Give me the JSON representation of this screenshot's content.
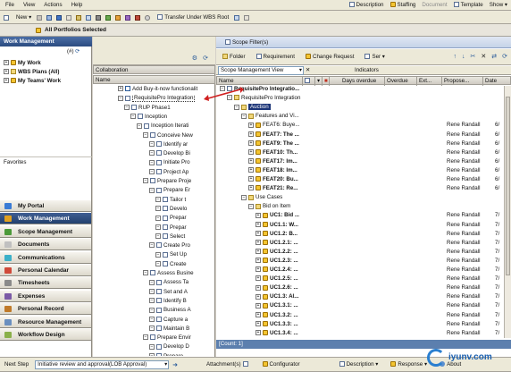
{
  "menubar": {
    "items": [
      "File",
      "View",
      "Actions",
      "Help"
    ],
    "right": [
      "Description",
      "Staffing",
      "Document",
      "Template",
      "Show"
    ]
  },
  "toolbar": {
    "new_label": "New",
    "transfer_label": "Transfer Under WBS Root",
    "scope_title": "All Portfolios Selected"
  },
  "left_panel": {
    "title": "Work Management",
    "items": [
      {
        "label": "My Work"
      },
      {
        "label": "WBS Plans (All)"
      },
      {
        "label": "My Teams' Work"
      }
    ],
    "count_label": "(#)",
    "favorites_label": "Favorites"
  },
  "nav": {
    "items": [
      {
        "label": "My Portal",
        "color": "#3a7bd5",
        "active": false
      },
      {
        "label": "Work Management",
        "color": "#e0a020",
        "active": true
      },
      {
        "label": "Scope Management",
        "color": "#4c9a3a",
        "active": false
      },
      {
        "label": "Documents",
        "color": "#c0c0c0",
        "active": false
      },
      {
        "label": "Communications",
        "color": "#3bb0c9",
        "active": false
      },
      {
        "label": "Personal Calendar",
        "color": "#d04a3a",
        "active": false
      },
      {
        "label": "Timesheets",
        "color": "#8a8a8a",
        "active": false
      },
      {
        "label": "Expenses",
        "color": "#7b5aa6",
        "active": false
      },
      {
        "label": "Personal Record",
        "color": "#c07a2a",
        "active": false
      },
      {
        "label": "Resource Management",
        "color": "#6a8fbf",
        "active": false
      },
      {
        "label": "Workflow Design",
        "color": "#8ab04a",
        "active": false
      }
    ]
  },
  "collab": {
    "header": "Collaboration",
    "name_col": "Name",
    "rows": [
      {
        "indent": 0,
        "icon": "plus",
        "text": "Add Buy-it-now functionalit"
      },
      {
        "indent": 0,
        "icon": "doc",
        "text": "RequisitePro Integration",
        "sel": true
      },
      {
        "indent": 1,
        "icon": "doc",
        "text": "RUP Phase1"
      },
      {
        "indent": 2,
        "icon": "doc",
        "text": "Inception"
      },
      {
        "indent": 3,
        "icon": "doc",
        "text": "Inception Iterati"
      },
      {
        "indent": 4,
        "icon": "doc",
        "text": "Conceive New"
      },
      {
        "indent": 5,
        "icon": "doc",
        "text": "Identify ar"
      },
      {
        "indent": 5,
        "icon": "doc",
        "text": "Develop Bi"
      },
      {
        "indent": 5,
        "icon": "doc",
        "text": "Initiate Pro"
      },
      {
        "indent": 5,
        "icon": "doc",
        "text": "Project Ap"
      },
      {
        "indent": 4,
        "icon": "doc",
        "text": "Prepare Proje"
      },
      {
        "indent": 5,
        "icon": "doc",
        "text": "Prepare Er"
      },
      {
        "indent": 6,
        "icon": "doc",
        "text": "Tailor t"
      },
      {
        "indent": 6,
        "icon": "doc",
        "text": "Develo"
      },
      {
        "indent": 6,
        "icon": "doc",
        "text": "Prepar"
      },
      {
        "indent": 6,
        "icon": "doc",
        "text": "Prepar"
      },
      {
        "indent": 6,
        "icon": "doc",
        "text": "Select"
      },
      {
        "indent": 5,
        "icon": "doc",
        "text": "Create Pro"
      },
      {
        "indent": 6,
        "icon": "doc",
        "text": "Set Up"
      },
      {
        "indent": 6,
        "icon": "doc",
        "text": "Create"
      },
      {
        "indent": 4,
        "icon": "doc",
        "text": "Assess Busine"
      },
      {
        "indent": 5,
        "icon": "doc",
        "text": "Assess Ta"
      },
      {
        "indent": 5,
        "icon": "doc",
        "text": "Set and A"
      },
      {
        "indent": 5,
        "icon": "doc",
        "text": "Identify B"
      },
      {
        "indent": 5,
        "icon": "doc",
        "text": "Business A"
      },
      {
        "indent": 5,
        "icon": "doc",
        "text": "Capture a"
      },
      {
        "indent": 5,
        "icon": "doc",
        "text": "Maintain B"
      },
      {
        "indent": 4,
        "icon": "doc",
        "text": "Prepare Envir"
      },
      {
        "indent": 5,
        "icon": "doc",
        "text": "Develop D"
      },
      {
        "indent": 5,
        "icon": "doc",
        "text": "Prepare"
      }
    ]
  },
  "scope": {
    "title": "Scope Filter(s)",
    "toolbar": [
      "Folder",
      "Requirement",
      "Change Request",
      "Ser"
    ],
    "view_label": "Scope Management View",
    "indicators_label": "Indicators",
    "columns": [
      "Name",
      "Days overdue",
      "Overdue",
      "Ext...",
      "Propose...",
      "Date"
    ],
    "rows": [
      {
        "indent": 0,
        "icon": "doc",
        "text": "RequisitePro Integratio...",
        "bold": true,
        "owner": "",
        "date": ""
      },
      {
        "indent": 1,
        "icon": "fld",
        "text": "RequisitePro Integration",
        "bold": false,
        "owner": "",
        "date": ""
      },
      {
        "indent": 2,
        "icon": "fld",
        "text": "Auction",
        "bold": false,
        "owner": "",
        "date": "",
        "sel": true
      },
      {
        "indent": 3,
        "icon": "fld",
        "text": "Features and Vi...",
        "bold": false,
        "owner": "",
        "date": ""
      },
      {
        "indent": 4,
        "icon": "gold",
        "text": "FEAT6: Buye...",
        "bold": false,
        "owner": "Rene Randall",
        "date": "6/"
      },
      {
        "indent": 4,
        "icon": "gold",
        "text": "FEAT7: The ...",
        "bold": true,
        "owner": "Rene Randall",
        "date": "6/"
      },
      {
        "indent": 4,
        "icon": "gold",
        "text": "FEAT9: The ...",
        "bold": true,
        "owner": "Rene Randall",
        "date": "6/"
      },
      {
        "indent": 4,
        "icon": "gold",
        "text": "FEAT10: Th...",
        "bold": true,
        "owner": "Rene Randall",
        "date": "6/"
      },
      {
        "indent": 4,
        "icon": "gold",
        "text": "FEAT17: Im...",
        "bold": true,
        "owner": "Rene Randall",
        "date": "6/"
      },
      {
        "indent": 4,
        "icon": "gold",
        "text": "FEAT18: Im...",
        "bold": true,
        "owner": "Rene Randall",
        "date": "6/"
      },
      {
        "indent": 4,
        "icon": "gold",
        "text": "FEAT20: Bu...",
        "bold": true,
        "owner": "Rene Randall",
        "date": "6/"
      },
      {
        "indent": 4,
        "icon": "gold",
        "text": "FEAT21: Re...",
        "bold": true,
        "owner": "Rene Randall",
        "date": "6/"
      },
      {
        "indent": 3,
        "icon": "fld",
        "text": "Use Cases",
        "bold": false,
        "owner": "",
        "date": ""
      },
      {
        "indent": 4,
        "icon": "fld",
        "text": "Bid on Item",
        "bold": false,
        "owner": "",
        "date": ""
      },
      {
        "indent": 5,
        "icon": "gold",
        "text": "UC1: Bid ...",
        "bold": true,
        "owner": "Rene Randall",
        "date": "7/"
      },
      {
        "indent": 5,
        "icon": "gold",
        "text": "UC1.1: W...",
        "bold": true,
        "owner": "Rene Randall",
        "date": "7/"
      },
      {
        "indent": 5,
        "icon": "gold",
        "text": "UC1.2: B...",
        "bold": true,
        "owner": "Rene Randall",
        "date": "7/"
      },
      {
        "indent": 5,
        "icon": "gold",
        "text": "UC1.2.1: ...",
        "bold": true,
        "owner": "Rene Randall",
        "date": "7/"
      },
      {
        "indent": 5,
        "icon": "gold",
        "text": "UC1.2.2: ...",
        "bold": true,
        "owner": "Rene Randall",
        "date": "7/"
      },
      {
        "indent": 5,
        "icon": "gold",
        "text": "UC1.2.3: ...",
        "bold": true,
        "owner": "Rene Randall",
        "date": "7/"
      },
      {
        "indent": 5,
        "icon": "gold",
        "text": "UC1.2.4: ...",
        "bold": true,
        "owner": "Rene Randall",
        "date": "7/"
      },
      {
        "indent": 5,
        "icon": "gold",
        "text": "UC1.2.5: ...",
        "bold": true,
        "owner": "Rene Randall",
        "date": "7/"
      },
      {
        "indent": 5,
        "icon": "gold",
        "text": "UC1.2.6: ...",
        "bold": true,
        "owner": "Rene Randall",
        "date": "7/"
      },
      {
        "indent": 5,
        "icon": "gold",
        "text": "UC1.3: Al...",
        "bold": true,
        "owner": "Rene Randall",
        "date": "7/"
      },
      {
        "indent": 5,
        "icon": "gold",
        "text": "UC1.3.1: ...",
        "bold": true,
        "owner": "Rene Randall",
        "date": "7/"
      },
      {
        "indent": 5,
        "icon": "gold",
        "text": "UC1.3.2: ...",
        "bold": true,
        "owner": "Rene Randall",
        "date": "7/"
      },
      {
        "indent": 5,
        "icon": "gold",
        "text": "UC1.3.3: ...",
        "bold": true,
        "owner": "Rene Randall",
        "date": "7/"
      },
      {
        "indent": 5,
        "icon": "gold",
        "text": "UC1.3.4: ...",
        "bold": true,
        "owner": "Rene Randall",
        "date": "7/"
      }
    ],
    "count_label": "[Count: 1]"
  },
  "status": {
    "next_step": "Next Step",
    "next_value": "Initiative review and approval(LOB Approval)",
    "attachments": "Attachment(s)",
    "configurator": "Configurator",
    "description": "Description",
    "response": "Response",
    "about": "About"
  },
  "watermark": {
    "text": "iyunv.com"
  }
}
